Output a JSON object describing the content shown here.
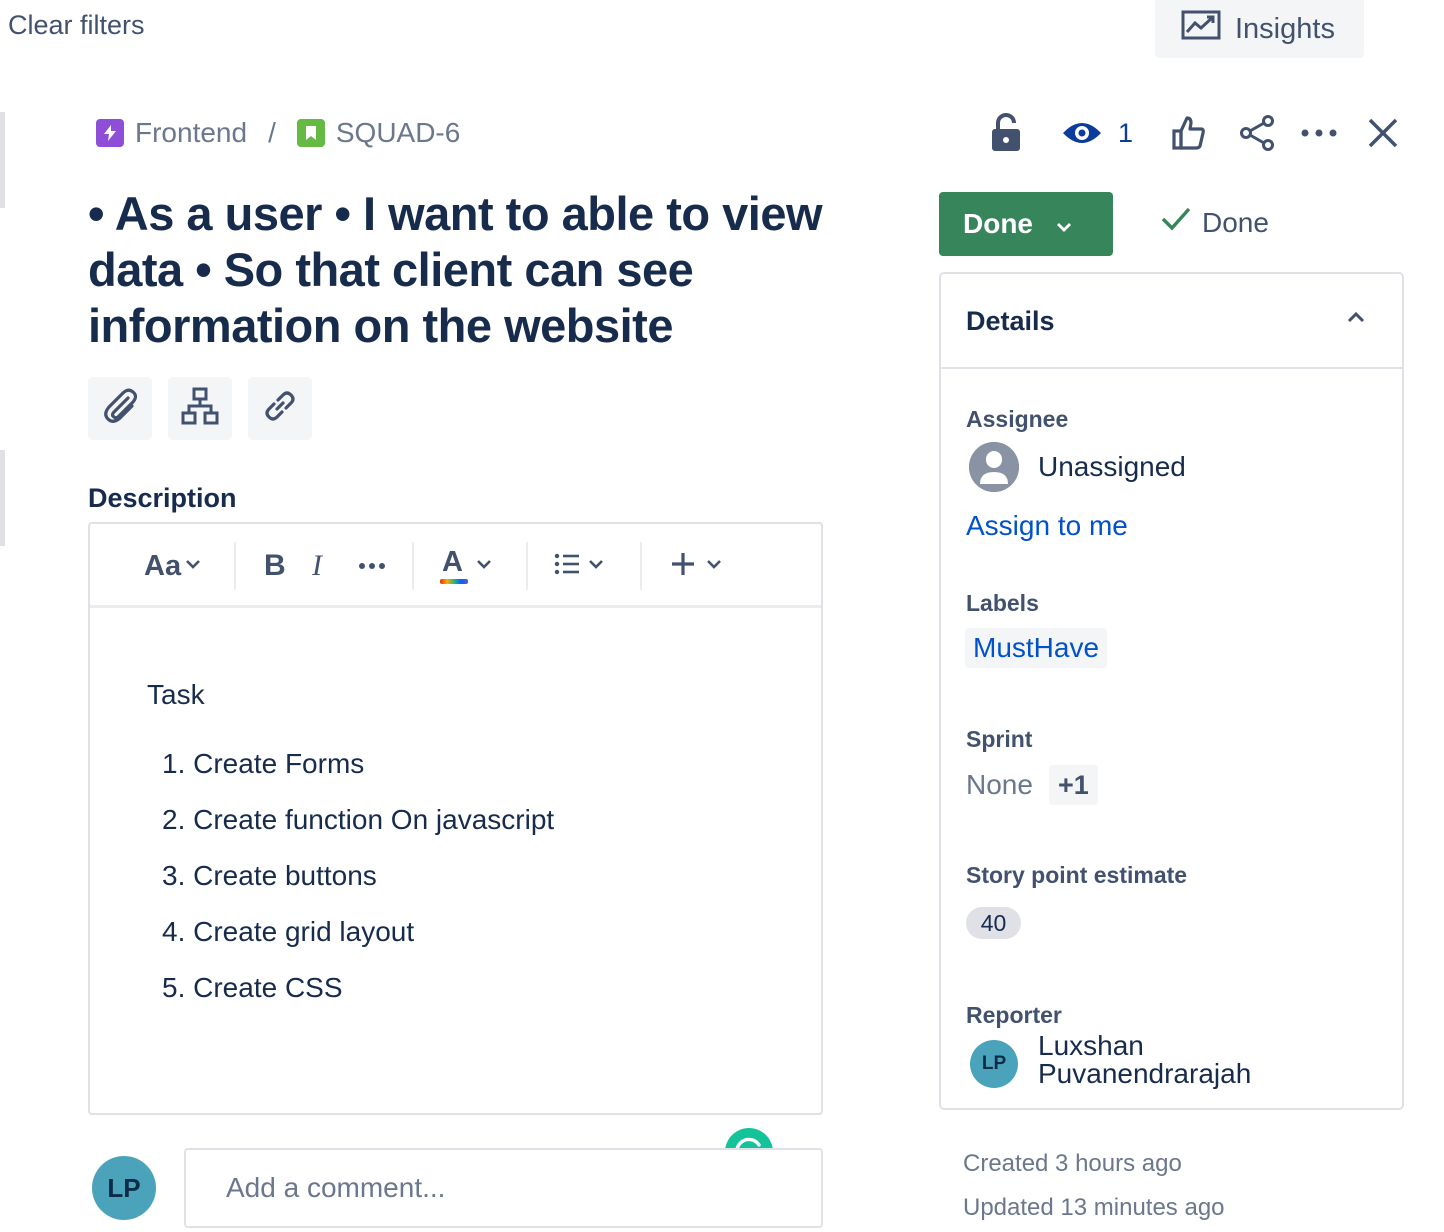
{
  "topbar": {
    "clear_filters": "Clear filters",
    "insights": "Insights"
  },
  "breadcrumb": {
    "project": "Frontend",
    "separator": "/",
    "issue_key": "SQUAD-6"
  },
  "header_actions": {
    "watchers_count": "1",
    "icons": [
      "lock-icon",
      "eye-icon",
      "thumbs-up-icon",
      "share-icon",
      "more-icon",
      "close-icon"
    ]
  },
  "issue": {
    "title": "• As a user • I want to able to view data • So that client can see information on the website"
  },
  "description": {
    "label": "Description",
    "toolbar": {
      "text_style": "Aa",
      "bold": "B",
      "italic": "I",
      "text_color": "A"
    },
    "body": {
      "heading": "Task",
      "items": [
        "1. Create Forms",
        "2. Create function On javascript",
        "3. Create buttons",
        "4. Create grid layout",
        "5. Create CSS"
      ]
    }
  },
  "comment": {
    "avatar_initials": "LP",
    "placeholder": "Add a comment..."
  },
  "status": {
    "button_label": "Done",
    "resolution": "Done"
  },
  "details": {
    "title": "Details",
    "assignee_label": "Assignee",
    "assignee_value": "Unassigned",
    "assign_to_me": "Assign to me",
    "labels_label": "Labels",
    "label_value": "MustHave",
    "sprint_label": "Sprint",
    "sprint_value": "None",
    "sprint_more": "+1",
    "story_points_label": "Story point estimate",
    "story_points_value": "40",
    "reporter_label": "Reporter",
    "reporter_initials": "LP",
    "reporter_name": "Luxshan Puvanendrarajah"
  },
  "meta": {
    "created": "Created 3 hours ago",
    "updated": "Updated 13 minutes ago"
  },
  "colors": {
    "status_done": "#37855b",
    "link": "#0052cc",
    "text": "#172b4d",
    "subtle": "#6b778c",
    "epic_purple": "#8f4ed8",
    "story_green": "#65ba43",
    "watch_blue": "#0c3c9b"
  }
}
